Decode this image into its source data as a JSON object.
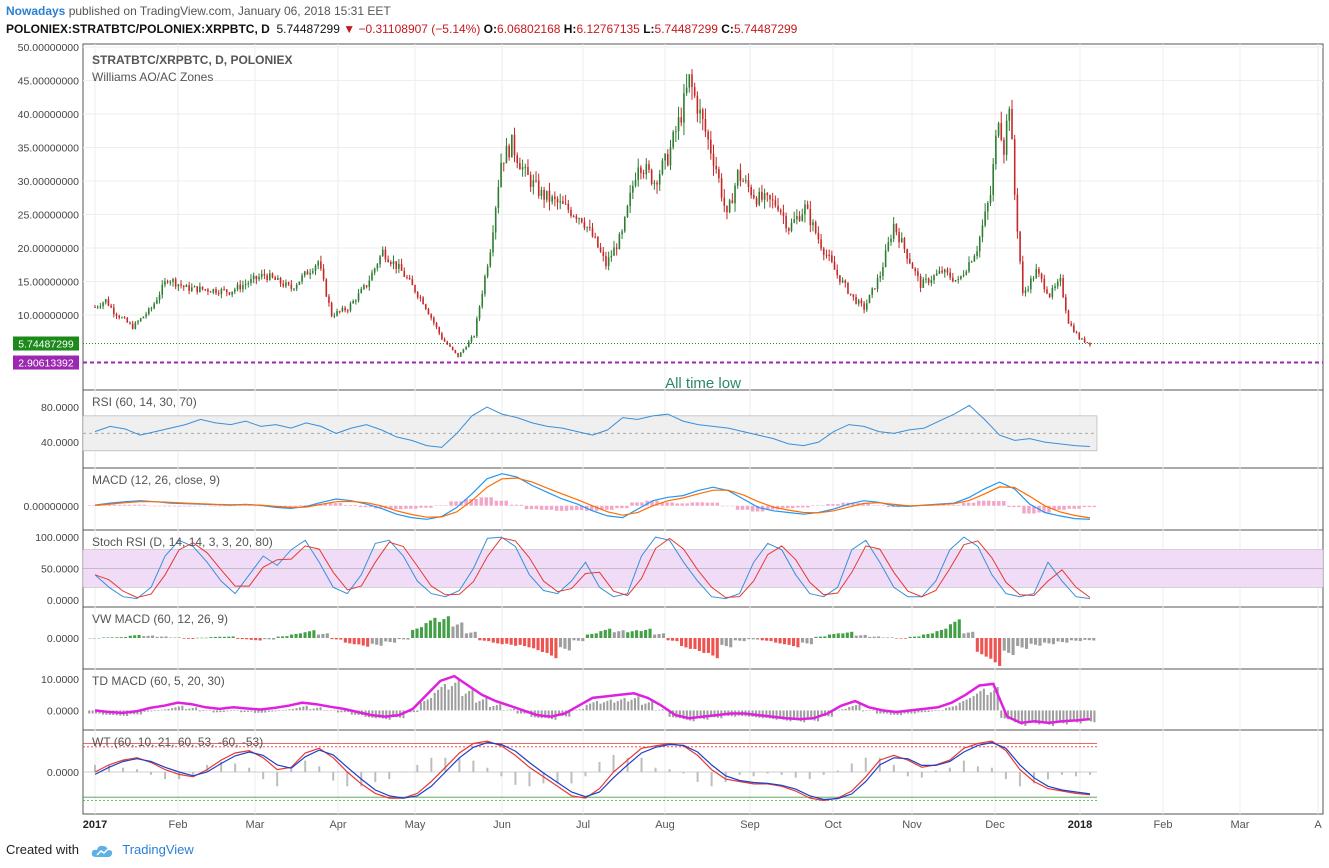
{
  "header": {
    "publisher": "Nowadays",
    "published_text": "published on TradingView.com, January 06, 2018 15:31 EET",
    "symbol": "POLONIEX:STRATBTC/POLONIEX:XRPBTC, D",
    "last": "5.74487299",
    "change": "−0.31108907 (−5.14%)",
    "open_label": "O:",
    "open": "6.06802168",
    "high_label": "H:",
    "high": "6.12767135",
    "low_label": "L:",
    "low": "5.74487299",
    "close_label": "C:",
    "close": "5.74487299"
  },
  "footer": {
    "created_with": "Created with",
    "brand": "TradingView"
  },
  "colors": {
    "up": "#2e7d32",
    "down": "#c62828",
    "rsi": "#3a8fd8",
    "macd": "#2196f3",
    "signal": "#ff6d00",
    "magenta": "#e020e0",
    "band": "#efefef",
    "stoch_band": "#f1dcf8",
    "low_line": "#9c27b0",
    "price_line": "#1b8a1b"
  },
  "chart_data": [
    {
      "type": "candlestick",
      "title": "STRATBTC/XRPBTC, D, POLONIEX",
      "subtitle": "Williams AO/AC Zones",
      "ylim": [
        0,
        50
      ],
      "y_ticks": [
        "50.00000000",
        "45.00000000",
        "40.00000000",
        "35.00000000",
        "30.00000000",
        "25.00000000",
        "20.00000000",
        "15.00000000",
        "10.00000000"
      ],
      "x_labels": [
        "2017",
        "Feb",
        "Mar",
        "Apr",
        "May",
        "Jun",
        "Jul",
        "Aug",
        "Sep",
        "Oct",
        "Nov",
        "Dec",
        "2018",
        "Feb",
        "Mar",
        "A"
      ],
      "current_price": 5.74487299,
      "current_price_label": "5.74487299",
      "all_time_low": 2.90613392,
      "all_time_low_label": "2.90613392",
      "annotation": "All time low",
      "close_series": [
        {
          "d": "2017-01-01",
          "v": 11.2
        },
        {
          "d": "2017-01-05",
          "v": 12.2
        },
        {
          "d": "2017-01-08",
          "v": 10.5
        },
        {
          "d": "2017-01-15",
          "v": 8.2
        },
        {
          "d": "2017-01-22",
          "v": 11.0
        },
        {
          "d": "2017-01-28",
          "v": 15.5
        },
        {
          "d": "2017-02-04",
          "v": 14.0
        },
        {
          "d": "2017-02-12",
          "v": 13.8
        },
        {
          "d": "2017-02-20",
          "v": 13.5
        },
        {
          "d": "2017-03-05",
          "v": 16.0
        },
        {
          "d": "2017-03-15",
          "v": 14.0
        },
        {
          "d": "2017-03-25",
          "v": 18.0
        },
        {
          "d": "2017-03-30",
          "v": 10.0
        },
        {
          "d": "2017-04-05",
          "v": 11.0
        },
        {
          "d": "2017-04-12",
          "v": 14.5
        },
        {
          "d": "2017-04-18",
          "v": 19.5
        },
        {
          "d": "2017-04-25",
          "v": 16.5
        },
        {
          "d": "2017-05-03",
          "v": 12.0
        },
        {
          "d": "2017-05-10",
          "v": 6.5
        },
        {
          "d": "2017-05-16",
          "v": 3.8
        },
        {
          "d": "2017-05-22",
          "v": 7.0
        },
        {
          "d": "2017-05-28",
          "v": 20.0
        },
        {
          "d": "2017-06-01",
          "v": 33.0
        },
        {
          "d": "2017-06-05",
          "v": 35.5
        },
        {
          "d": "2017-06-10",
          "v": 31.0
        },
        {
          "d": "2017-06-16",
          "v": 28.0
        },
        {
          "d": "2017-06-25",
          "v": 26.0
        },
        {
          "d": "2017-07-01",
          "v": 24.5
        },
        {
          "d": "2017-07-06",
          "v": 21.0
        },
        {
          "d": "2017-07-10",
          "v": 17.5
        },
        {
          "d": "2017-07-16",
          "v": 22.0
        },
        {
          "d": "2017-07-22",
          "v": 33.0
        },
        {
          "d": "2017-07-28",
          "v": 30.0
        },
        {
          "d": "2017-08-02",
          "v": 33.5
        },
        {
          "d": "2017-08-07",
          "v": 40.0
        },
        {
          "d": "2017-08-10",
          "v": 45.0
        },
        {
          "d": "2017-08-14",
          "v": 40.0
        },
        {
          "d": "2017-08-20",
          "v": 32.0
        },
        {
          "d": "2017-08-24",
          "v": 24.5
        },
        {
          "d": "2017-08-28",
          "v": 31.0
        },
        {
          "d": "2017-09-04",
          "v": 27.5
        },
        {
          "d": "2017-09-12",
          "v": 26.5
        },
        {
          "d": "2017-09-16",
          "v": 23.0
        },
        {
          "d": "2017-09-22",
          "v": 26.0
        },
        {
          "d": "2017-09-28",
          "v": 20.5
        },
        {
          "d": "2017-10-04",
          "v": 16.0
        },
        {
          "d": "2017-10-10",
          "v": 12.5
        },
        {
          "d": "2017-10-14",
          "v": 11.0
        },
        {
          "d": "2017-10-20",
          "v": 16.0
        },
        {
          "d": "2017-10-25",
          "v": 23.5
        },
        {
          "d": "2017-10-30",
          "v": 19.0
        },
        {
          "d": "2017-11-04",
          "v": 14.5
        },
        {
          "d": "2017-11-12",
          "v": 16.5
        },
        {
          "d": "2017-11-18",
          "v": 15.0
        },
        {
          "d": "2017-11-25",
          "v": 20.0
        },
        {
          "d": "2017-11-30",
          "v": 28.0
        },
        {
          "d": "2017-12-03",
          "v": 40.0
        },
        {
          "d": "2017-12-05",
          "v": 35.0
        },
        {
          "d": "2017-12-07",
          "v": 42.0
        },
        {
          "d": "2017-12-09",
          "v": 28.0
        },
        {
          "d": "2017-12-12",
          "v": 13.0
        },
        {
          "d": "2017-12-17",
          "v": 16.5
        },
        {
          "d": "2017-12-22",
          "v": 13.0
        },
        {
          "d": "2017-12-26",
          "v": 15.0
        },
        {
          "d": "2017-12-29",
          "v": 9.0
        },
        {
          "d": "2018-01-02",
          "v": 6.5
        },
        {
          "d": "2018-01-06",
          "v": 5.74
        }
      ]
    },
    {
      "type": "line",
      "title": "RSI (60, 14, 30, 70)",
      "y_ticks": [
        "80.0000",
        "40.0000"
      ],
      "ylim": [
        15,
        95
      ],
      "band": [
        30,
        70
      ],
      "midline": 50,
      "series": [
        {
          "values": [
            52,
            58,
            55,
            48,
            52,
            56,
            60,
            66,
            62,
            60,
            64,
            58,
            60,
            56,
            62,
            58,
            50,
            56,
            60,
            54,
            46,
            42,
            36,
            34,
            50,
            70,
            80,
            72,
            68,
            62,
            58,
            56,
            52,
            48,
            54,
            68,
            66,
            70,
            72,
            64,
            60,
            58,
            56,
            52,
            48,
            44,
            38,
            36,
            40,
            52,
            60,
            58,
            52,
            50,
            54,
            56,
            64,
            72,
            82,
            66,
            48,
            42,
            44,
            40,
            38,
            36,
            35
          ]
        }
      ]
    },
    {
      "type": "line",
      "title": "MACD (12, 26, close, 9)",
      "y_ticks": [
        "0.00000000"
      ],
      "ylim": [
        -6,
        10
      ],
      "series": [
        {
          "name": "MACD",
          "values": [
            0.2,
            0.8,
            1.2,
            1.5,
            1.2,
            0.8,
            0.6,
            0.5,
            0.3,
            0.2,
            0.4,
            0.1,
            -0.5,
            -0.8,
            -0.2,
            1.0,
            2.0,
            1.5,
            0.5,
            -0.8,
            -2.5,
            -3.5,
            -4.0,
            -3.2,
            -0.5,
            3.5,
            8.0,
            9.5,
            8.5,
            6.0,
            4.0,
            2.0,
            0.5,
            -1.5,
            -3.0,
            -3.5,
            -1.0,
            1.5,
            2.5,
            3.0,
            4.5,
            5.5,
            4.5,
            2.0,
            -0.5,
            -1.5,
            -2.0,
            -2.5,
            -2.0,
            -1.0,
            0.5,
            1.5,
            1.0,
            0.0,
            -0.2,
            0.2,
            0.5,
            0.8,
            2.5,
            5.0,
            7.0,
            5.0,
            0.5,
            -2.0,
            -3.0,
            -3.8,
            -4.0
          ]
        },
        {
          "name": "Signal",
          "values": [
            0.1,
            0.5,
            0.9,
            1.2,
            1.2,
            1.0,
            0.8,
            0.6,
            0.4,
            0.3,
            0.3,
            0.2,
            -0.2,
            -0.5,
            -0.4,
            0.4,
            1.2,
            1.3,
            0.9,
            0.0,
            -1.5,
            -2.6,
            -3.4,
            -3.3,
            -1.8,
            1.5,
            5.5,
            8.0,
            8.2,
            7.0,
            5.2,
            3.5,
            1.8,
            0.0,
            -1.8,
            -2.8,
            -2.0,
            0.0,
            1.5,
            2.3,
            3.5,
            4.6,
            4.6,
            3.2,
            1.2,
            -0.4,
            -1.3,
            -2.0,
            -2.1,
            -1.5,
            -0.4,
            0.7,
            0.9,
            0.4,
            0.0,
            0.1,
            0.3,
            0.6,
            1.6,
            3.5,
            5.6,
            5.4,
            2.8,
            0.0,
            -1.8,
            -2.9,
            -3.6
          ]
        }
      ]
    },
    {
      "type": "line",
      "title": "Stoch RSI (D, 14, 14, 3, 3, 20, 80)",
      "y_ticks": [
        "100.0000",
        "50.0000",
        "0.0000"
      ],
      "ylim": [
        -5,
        105
      ],
      "band": [
        20,
        80
      ],
      "midline": 50,
      "series": [
        {
          "values": [
            40,
            20,
            5,
            2,
            20,
            70,
            95,
            85,
            60,
            30,
            10,
            40,
            70,
            55,
            80,
            95,
            60,
            20,
            10,
            40,
            90,
            95,
            70,
            30,
            10,
            5,
            15,
            50,
            98,
            100,
            85,
            40,
            15,
            10,
            30,
            60,
            20,
            5,
            10,
            70,
            100,
            95,
            60,
            30,
            5,
            2,
            10,
            60,
            90,
            80,
            40,
            10,
            5,
            20,
            80,
            95,
            60,
            20,
            5,
            5,
            30,
            80,
            100,
            85,
            40,
            10,
            5,
            10,
            60,
            30,
            5,
            2
          ]
        }
      ]
    },
    {
      "type": "bar",
      "title": "VW MACD (60, 12, 26, 9)",
      "y_ticks": [
        "0.0000"
      ],
      "ylim": [
        -10,
        10
      ],
      "values": [
        0,
        0.2,
        0.3,
        1.0,
        0.8,
        0.5,
        0.2,
        -0.3,
        0.1,
        0.4,
        0.5,
        -0.4,
        -0.8,
        -0.5,
        0.6,
        1.5,
        2.5,
        1.5,
        -0.5,
        -2.0,
        -2.8,
        -2.5,
        -1.5,
        -0.5,
        3.5,
        6.5,
        7.0,
        5.0,
        2.0,
        -1.0,
        -2.0,
        -2.5,
        -3.0,
        -4.5,
        -6.5,
        -4.0,
        -1.0,
        1.5,
        3.0,
        2.5,
        2.5,
        3.0,
        1.5,
        -1.0,
        -3.5,
        -4.8,
        -6.5,
        -3.0,
        -1.0,
        -0.5,
        -1.0,
        -2.0,
        -3.0,
        -2.0,
        0.5,
        1.5,
        2.0,
        1.0,
        0.5,
        0.2,
        -0.2,
        0.5,
        1.5,
        3.0,
        6.0,
        2.0,
        -6.0,
        -9.0,
        -5.5,
        -3.5,
        -2.5,
        -2.0,
        -1.5,
        -1.0,
        -0.8
      ]
    },
    {
      "type": "line",
      "title": "TD MACD (60, 5, 20, 30)",
      "y_ticks": [
        "10.0000",
        "0.0000"
      ],
      "ylim": [
        -5,
        12
      ],
      "series": [
        {
          "values": [
            0,
            -0.5,
            -0.8,
            -0.3,
            0.8,
            1.5,
            2.5,
            2.0,
            1.0,
            0.5,
            1.0,
            0.6,
            0.3,
            0.8,
            1.5,
            2.5,
            2.0,
            1.2,
            0.5,
            -0.5,
            -1.5,
            -2.0,
            -1.5,
            0.5,
            5.0,
            9.5,
            11.0,
            8.0,
            5.0,
            3.0,
            1.5,
            0.0,
            -1.5,
            -2.0,
            -1.0,
            1.5,
            4.0,
            4.5,
            5.0,
            5.5,
            4.0,
            1.5,
            -1.5,
            -2.5,
            -2.0,
            -1.5,
            -1.0,
            -1.0,
            -1.5,
            -2.0,
            -2.5,
            -2.8,
            -2.5,
            -1.0,
            1.5,
            3.0,
            1.0,
            0.0,
            -0.5,
            0.0,
            0.5,
            1.0,
            2.5,
            5.0,
            8.0,
            8.5,
            -2.0,
            -4.0,
            -3.5,
            -4.0,
            -3.5,
            -3.2,
            -2.8
          ]
        }
      ]
    },
    {
      "type": "line",
      "title": "WT (60, 10, 21, 60, 53, -60, -53)",
      "y_ticks": [
        "0.0000"
      ],
      "ylim": [
        -80,
        80
      ],
      "levels": [
        60,
        53,
        -53,
        -60
      ],
      "series": [
        {
          "name": "WT1",
          "values": [
            0,
            15,
            25,
            30,
            20,
            5,
            -5,
            -10,
            5,
            25,
            40,
            45,
            30,
            5,
            10,
            40,
            50,
            30,
            0,
            -25,
            -45,
            -55,
            -55,
            -45,
            -20,
            10,
            40,
            60,
            65,
            55,
            35,
            10,
            -10,
            -30,
            -50,
            -55,
            -35,
            0,
            25,
            50,
            55,
            60,
            55,
            35,
            5,
            -15,
            -20,
            -25,
            -25,
            -30,
            -40,
            -55,
            -60,
            -55,
            -40,
            -10,
            25,
            35,
            25,
            10,
            15,
            25,
            50,
            60,
            65,
            45,
            5,
            -20,
            -35,
            -40,
            -45,
            -48
          ]
        },
        {
          "name": "WT2",
          "values": [
            -5,
            10,
            22,
            28,
            22,
            10,
            0,
            -8,
            0,
            18,
            34,
            42,
            35,
            15,
            8,
            32,
            46,
            36,
            10,
            -15,
            -38,
            -50,
            -55,
            -50,
            -30,
            0,
            30,
            52,
            62,
            58,
            44,
            20,
            -2,
            -22,
            -42,
            -52,
            -42,
            -12,
            15,
            40,
            52,
            58,
            56,
            42,
            15,
            -8,
            -18,
            -22,
            -24,
            -28,
            -36,
            -50,
            -58,
            -56,
            -46,
            -20,
            15,
            30,
            28,
            14,
            14,
            22,
            42,
            56,
            62,
            50,
            15,
            -12,
            -30,
            -38,
            -42,
            -46
          ]
        }
      ]
    }
  ]
}
